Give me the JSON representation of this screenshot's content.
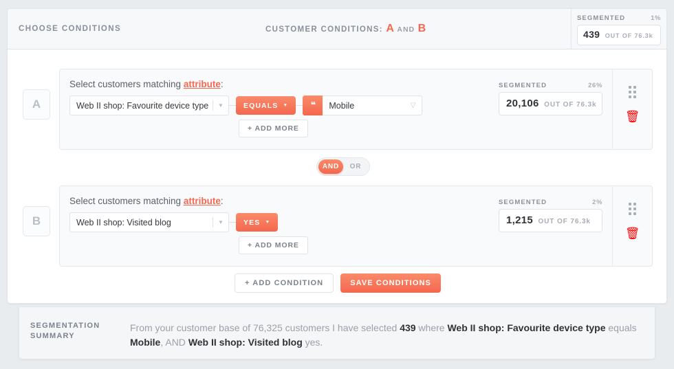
{
  "header": {
    "choose_conditions": "CHOOSE CONDITIONS",
    "customer_conditions_label": "CUSTOMER CONDITIONS:",
    "condition_a": "A",
    "and_word": "AND",
    "condition_b": "B",
    "segmented_label": "SEGMENTED",
    "segmented_pct": "1%",
    "segmented_count": "439",
    "segmented_outof": "OUT OF 76.3k"
  },
  "conditions": [
    {
      "letter": "A",
      "match_prefix": "Select customers matching",
      "attribute_link": "attribute",
      "match_suffix": ":",
      "attribute_value": "Web II shop: Favourite device type",
      "operator": "EQUALS",
      "value_icon": "❝",
      "value": "Mobile",
      "add_more": "+ ADD MORE",
      "segmented_label": "SEGMENTED",
      "segmented_pct": "26%",
      "segmented_count": "20,106",
      "segmented_outof": "OUT OF 76.3k"
    },
    {
      "letter": "B",
      "match_prefix": "Select customers matching",
      "attribute_link": "attribute",
      "match_suffix": ":",
      "attribute_value": "Web II shop: Visited blog",
      "operator": "YES",
      "add_more": "+ ADD MORE",
      "segmented_label": "SEGMENTED",
      "segmented_pct": "2%",
      "segmented_count": "1,215",
      "segmented_outof": "OUT OF 76.3k"
    }
  ],
  "logic_toggle": {
    "and_label": "AND",
    "or_label": "OR",
    "selected": "AND"
  },
  "actions": {
    "add_condition": "+ ADD CONDITION",
    "save_conditions": "SAVE CONDITIONS"
  },
  "summary": {
    "title_line1": "SEGMENTATION",
    "title_line2": "SUMMARY",
    "part1": "From your customer base of 76,325 customers I have selected ",
    "selected_count": "439",
    "part2": " where ",
    "attr1": "Web II shop: Favourite device type",
    "part3": " equals ",
    "value1": "Mobile",
    "part4": ", AND ",
    "attr2": "Web II shop: Visited blog",
    "part5": " yes."
  },
  "colors": {
    "accent": "#f4684f",
    "danger": "#ff0000",
    "page_bg": "#e9ecef"
  }
}
